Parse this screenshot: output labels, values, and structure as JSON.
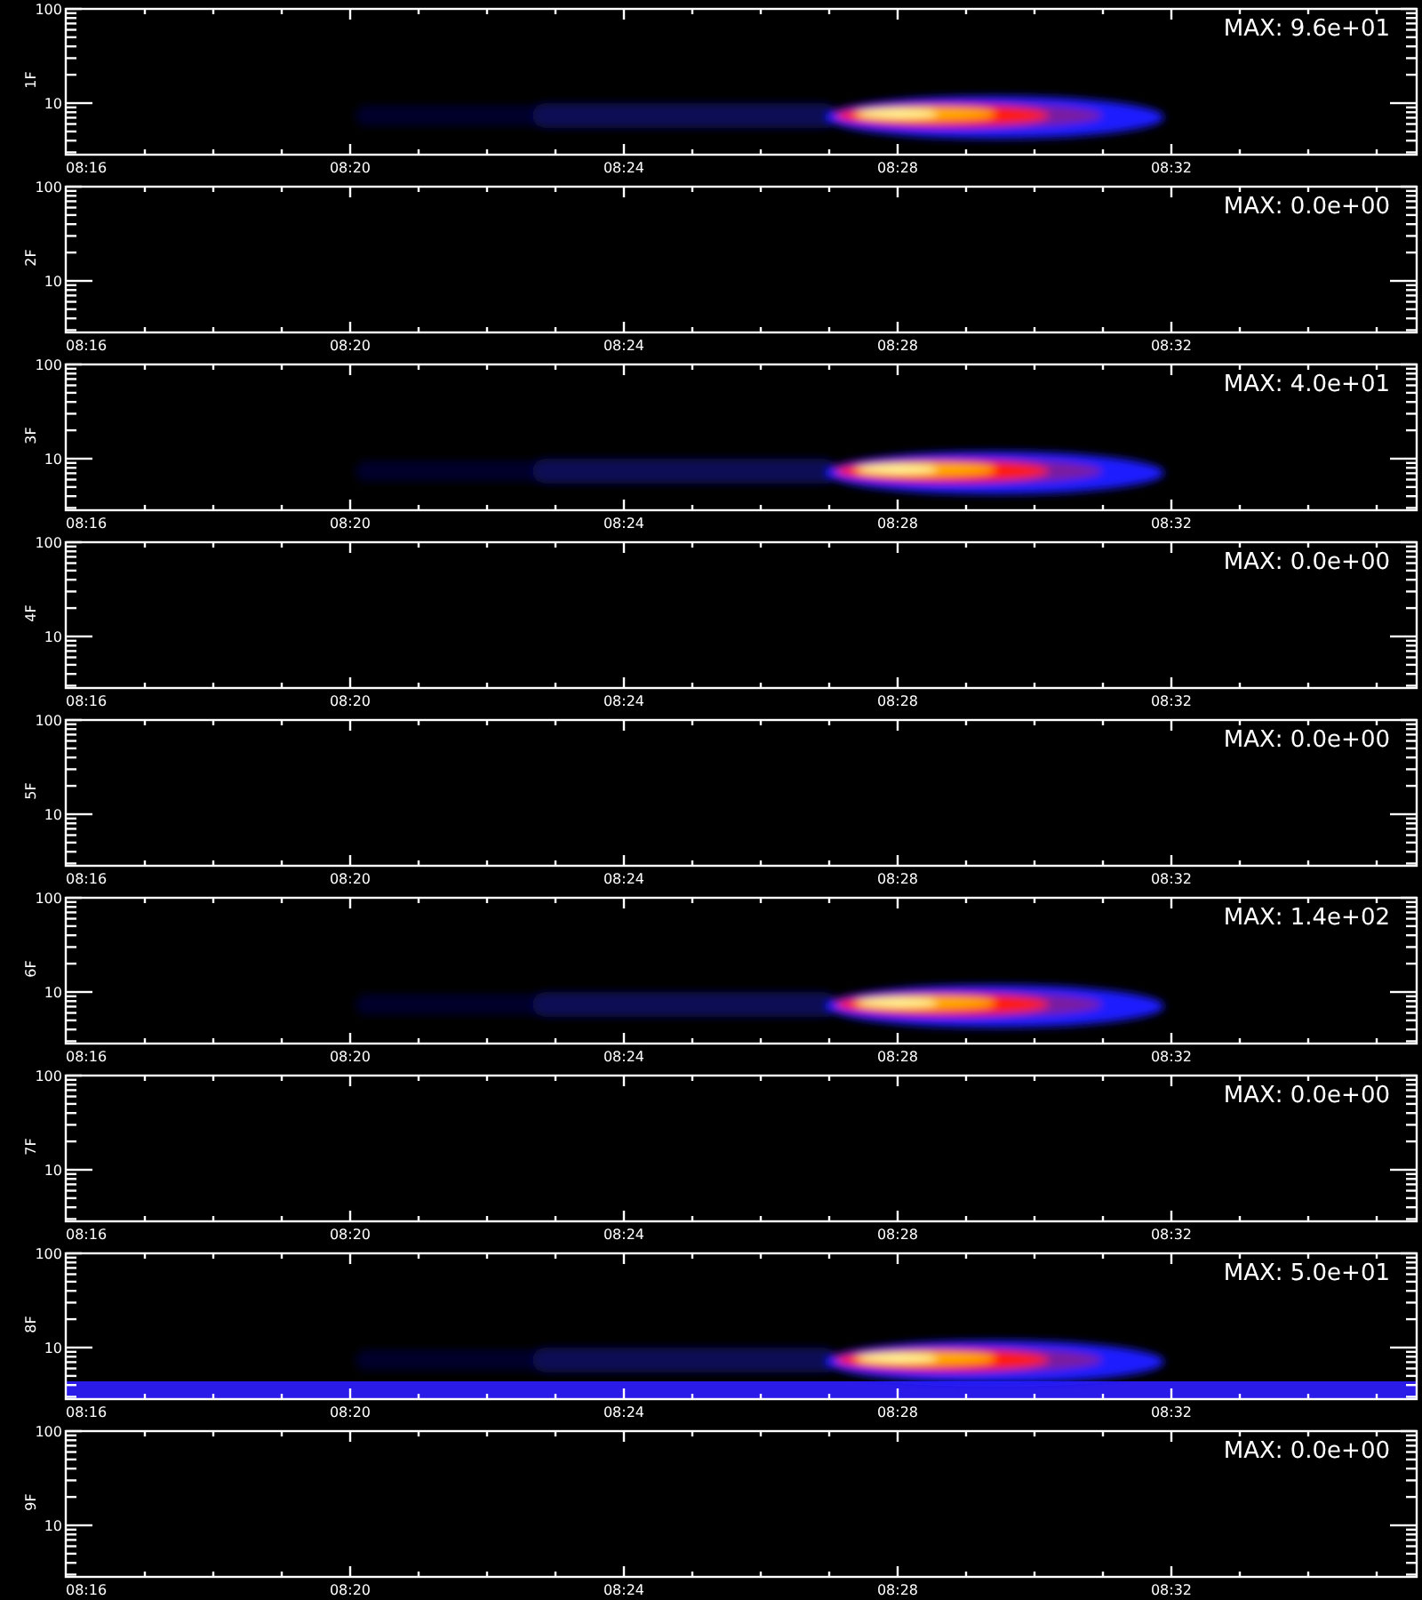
{
  "panels": [
    {
      "label": "1F",
      "y_ticks": [
        "100",
        "10"
      ],
      "x_ticks": [
        "08:16",
        "08:20",
        "08:24",
        "08:28",
        "08:32"
      ],
      "max_text": "MAX: 9.6e+01",
      "burst": true,
      "baseline_band": false
    },
    {
      "label": "2F",
      "y_ticks": [
        "100",
        "10"
      ],
      "x_ticks": [
        "08:16",
        "08:20",
        "08:24",
        "08:28",
        "08:32"
      ],
      "max_text": "MAX: 0.0e+00",
      "burst": false,
      "baseline_band": false
    },
    {
      "label": "3F",
      "y_ticks": [
        "100",
        "10"
      ],
      "x_ticks": [
        "08:16",
        "08:20",
        "08:24",
        "08:28",
        "08:32"
      ],
      "max_text": "MAX: 4.0e+01",
      "burst": true,
      "baseline_band": false
    },
    {
      "label": "4F",
      "y_ticks": [
        "100",
        "10"
      ],
      "x_ticks": [
        "08:16",
        "08:20",
        "08:24",
        "08:28",
        "08:32"
      ],
      "max_text": "MAX: 0.0e+00",
      "burst": false,
      "baseline_band": false
    },
    {
      "label": "5F",
      "y_ticks": [
        "100",
        "10"
      ],
      "x_ticks": [
        "08:16",
        "08:20",
        "08:24",
        "08:28",
        "08:32"
      ],
      "max_text": "MAX: 0.0e+00",
      "burst": false,
      "baseline_band": false
    },
    {
      "label": "6F",
      "y_ticks": [
        "100",
        "10"
      ],
      "x_ticks": [
        "08:16",
        "08:20",
        "08:24",
        "08:28",
        "08:32"
      ],
      "max_text": "MAX: 1.4e+02",
      "burst": true,
      "baseline_band": false
    },
    {
      "label": "7F",
      "y_ticks": [
        "100",
        "10"
      ],
      "x_ticks": [
        "08:16",
        "08:20",
        "08:24",
        "08:28",
        "08:32"
      ],
      "max_text": "MAX: 0.0e+00",
      "burst": false,
      "baseline_band": false
    },
    {
      "label": "8F",
      "y_ticks": [
        "100",
        "10"
      ],
      "x_ticks": [
        "08:16",
        "08:20",
        "08:24",
        "08:28",
        "08:32"
      ],
      "max_text": "MAX: 5.0e+01",
      "burst": true,
      "baseline_band": true
    },
    {
      "label": "9F",
      "y_ticks": [
        "100",
        "10"
      ],
      "x_ticks": [
        "08:16",
        "08:20",
        "08:24",
        "08:28",
        "08:32"
      ],
      "max_text": "MAX: 0.0e+00",
      "burst": false,
      "baseline_band": false
    }
  ]
}
